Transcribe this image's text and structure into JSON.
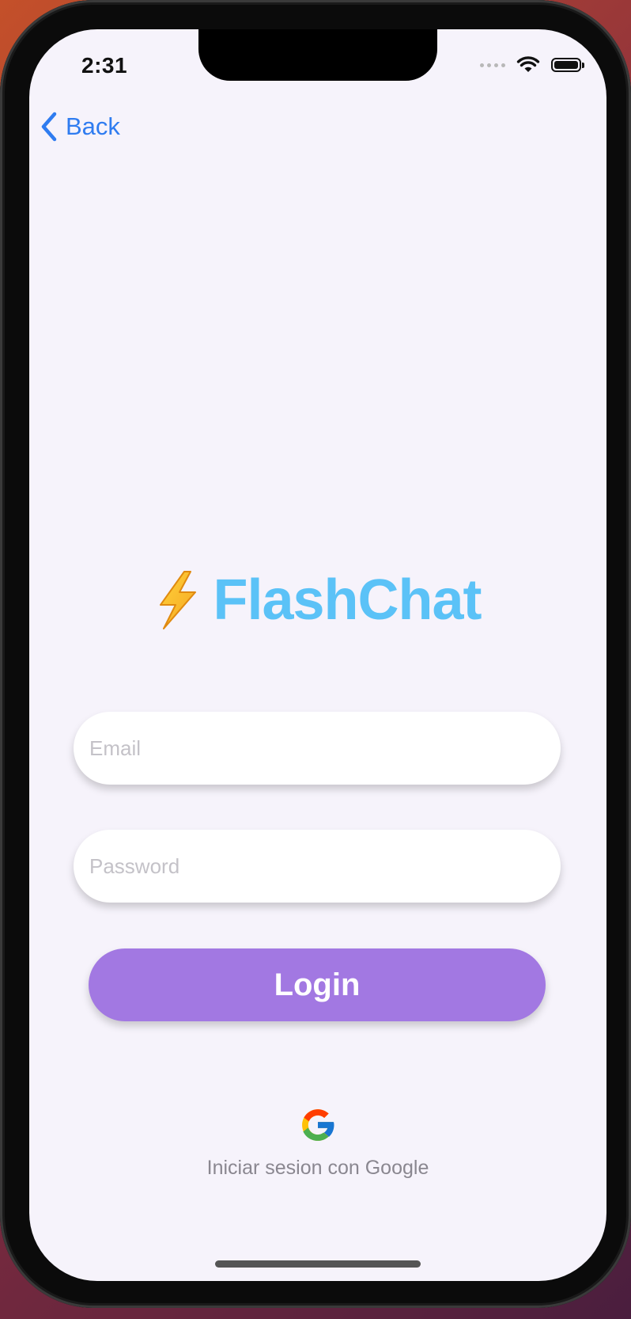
{
  "status_bar": {
    "time": "2:31"
  },
  "nav": {
    "back_label": "Back"
  },
  "logo": {
    "emoji": "⚡",
    "title": "FlashChat"
  },
  "form": {
    "email_placeholder": "Email",
    "password_placeholder": "Password",
    "login_label": "Login"
  },
  "google": {
    "label": "Iniciar sesion con Google",
    "icon": "google-logo-icon"
  },
  "colors": {
    "accent_blue": "#2f7cf0",
    "logo_blue": "#5bc2f7",
    "login_purple": "#a278e2",
    "screen_bg": "#f6f3fb"
  }
}
